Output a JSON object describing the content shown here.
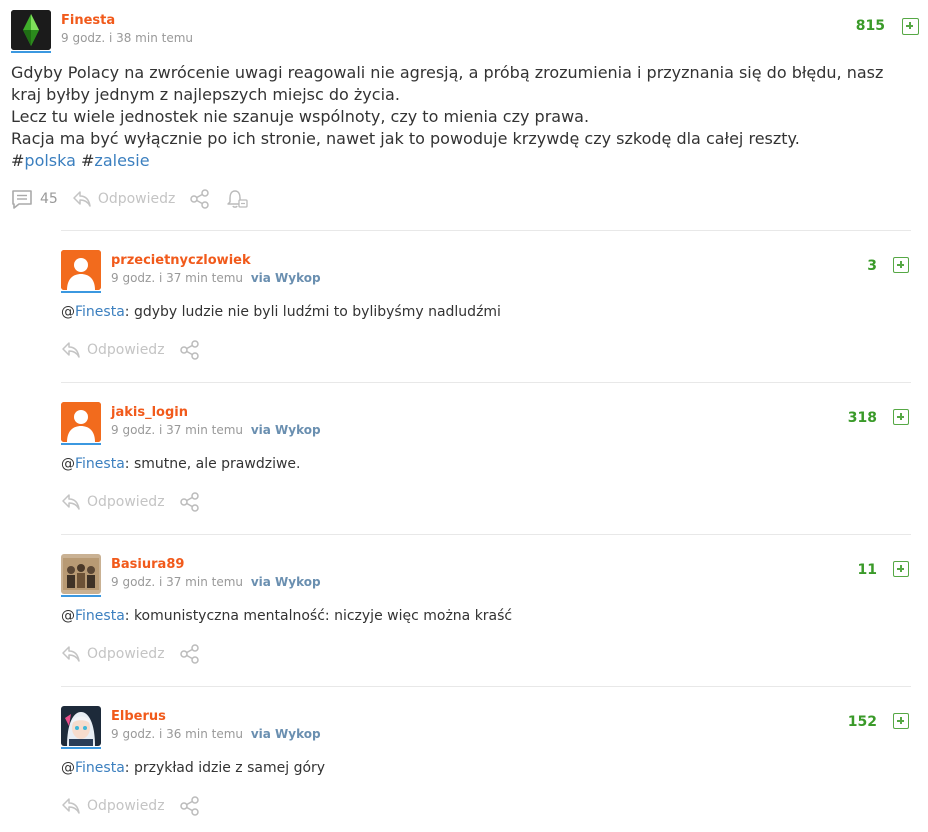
{
  "post": {
    "author": "Finesta",
    "time": "9 godz. i 38 min temu",
    "votes": "815",
    "lines": [
      "Gdyby Polacy na zwrócenie uwagi reagowali nie agresją, a próbą zrozumienia i przyznania się do błędu, nasz kraj byłby jednym z najlepszych miejsc do życia.",
      "Lecz tu wiele jednostek nie szanuje wspólnoty, czy to mienia czy prawa.",
      "Racja ma być wyłącznie po ich stronie, nawet jak to powoduje krzywdę czy szkodę dla całej reszty."
    ],
    "tags": [
      "polska",
      "zalesie"
    ],
    "comments_count": "45",
    "reply_label": "Odpowiedz"
  },
  "comments": [
    {
      "author": "przecietnyczlowiek",
      "time": "9 godz. i 37 min temu",
      "via": "via Wykop",
      "votes": "3",
      "mention": "Finesta",
      "text": ": gdyby ludzie nie byli ludźmi to bylibyśmy nadludźmi",
      "reply_label": "Odpowiedz"
    },
    {
      "author": "jakis_login",
      "time": "9 godz. i 37 min temu",
      "via": "via Wykop",
      "votes": "318",
      "mention": "Finesta",
      "text": ": smutne, ale prawdziwe.",
      "reply_label": "Odpowiedz"
    },
    {
      "author": "Basiura89",
      "time": "9 godz. i 37 min temu",
      "via": "via Wykop",
      "votes": "11",
      "mention": "Finesta",
      "text": ": komunistyczna mentalność: niczyje więc można kraść",
      "reply_label": "Odpowiedz"
    },
    {
      "author": "Elberus",
      "time": "9 godz. i 36 min temu",
      "via": "via Wykop",
      "votes": "152",
      "mention": "Finesta",
      "text": ": przykład idzie z samej góry",
      "reply_label": "Odpowiedz"
    }
  ],
  "colors": {
    "author": "#f15a1b",
    "votes": "#3a9a29",
    "link": "#3b7fbf",
    "default_avatar": "#f26b1d"
  }
}
